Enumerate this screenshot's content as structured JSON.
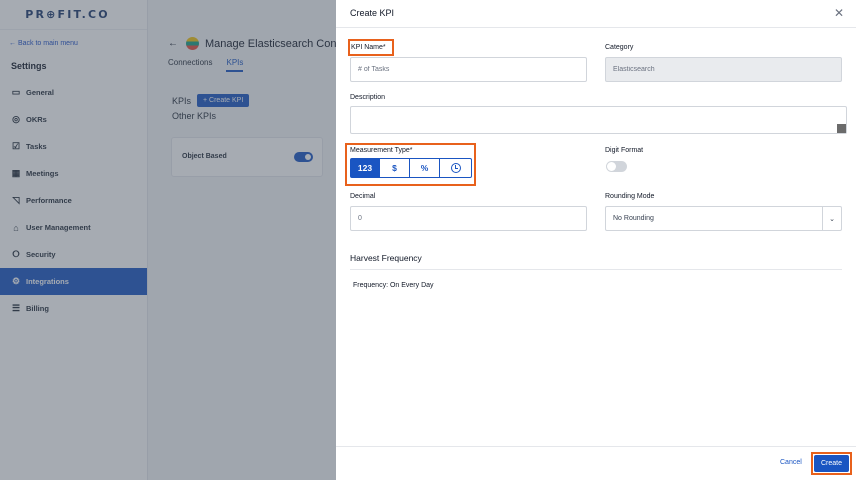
{
  "sidebar": {
    "logo": "PR⊕FIT.CO",
    "back_link": "← Back to main menu",
    "title": "Settings",
    "items": [
      {
        "label": "General",
        "icon": "▭"
      },
      {
        "label": "OKRs",
        "icon": "◎"
      },
      {
        "label": "Tasks",
        "icon": "☑"
      },
      {
        "label": "Meetings",
        "icon": "▦"
      },
      {
        "label": "Performance",
        "icon": "◹"
      },
      {
        "label": "User Management",
        "icon": "⌂"
      },
      {
        "label": "Security",
        "icon": "⭘"
      },
      {
        "label": "Integrations",
        "icon": "⚙"
      },
      {
        "label": "Billing",
        "icon": "☰"
      }
    ],
    "active_item": "Integrations"
  },
  "main": {
    "back_arrow": "←",
    "page_title": "Manage Elasticsearch Con",
    "tabs": [
      "Connections",
      "KPIs"
    ],
    "active_tab": "KPIs",
    "kpis_label": "KPIs",
    "create_kpi_button": "+ Create KPI",
    "other_kpis_label": "Other KPIs",
    "object_based_label": "Object Based",
    "object_based_enabled": true
  },
  "drawer": {
    "title": "Create KPI",
    "close_icon": "✕",
    "kpi_name_label": "KPI Name*",
    "kpi_name_placeholder": "# of Tasks",
    "category_label": "Category",
    "category_value": "Elasticsearch",
    "description_label": "Description",
    "measurement_type_label": "Measurement Type*",
    "measurement_options": [
      "123",
      "$",
      "%",
      "clock-icon"
    ],
    "measurement_selected": "123",
    "digit_format_label": "Digit Format",
    "digit_format_enabled": false,
    "decimal_label": "Decimal",
    "decimal_placeholder": "0",
    "rounding_mode_label": "Rounding Mode",
    "rounding_mode_value": "No Rounding",
    "rounding_caret": "⌄",
    "harvest_title": "Harvest Frequency",
    "frequency_text": "Frequency:  On Every Day",
    "cancel_label": "Cancel",
    "create_label": "Create"
  },
  "colors": {
    "accent": "#1a55c2",
    "highlight": "#e8611c",
    "overlay": "rgba(70,80,95,0.48)"
  }
}
